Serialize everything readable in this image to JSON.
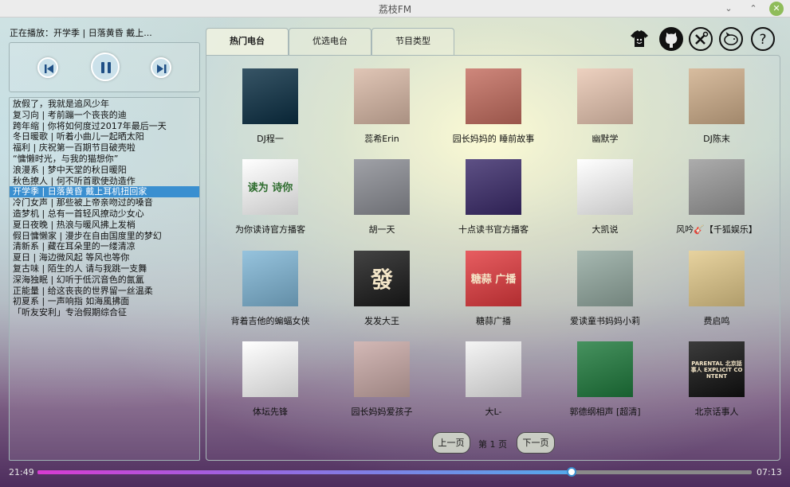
{
  "window": {
    "title": "荔枝FM"
  },
  "now_playing": {
    "label": "正在播放：",
    "text": "开学季 | 日落黄昏 戴上..."
  },
  "controls": {
    "prev_icon": "skip-previous-icon",
    "pause_icon": "pause-icon",
    "next_icon": "skip-next-icon"
  },
  "playlist": [
    {
      "text": "放假了，我就是追风少年"
    },
    {
      "text": "复习向 | 考前蹦一个丧丧的迪"
    },
    {
      "text": "跨年缩 | 你将如何度过2017年最后一天"
    },
    {
      "text": "冬日暖歌 | 听着小曲儿一起晒太阳"
    },
    {
      "text": "福利 | 庆祝第一百期节目破壳啦"
    },
    {
      "text": "“慵懒时光，与我的猫想你”"
    },
    {
      "text": "浪漫系 | 梦中天堂的秋日暖阳"
    },
    {
      "text": "秋色撩人 | 何不听首歌使劲造作"
    },
    {
      "text": "开学季 | 日落黄昏 戴上耳机扭回家",
      "active": true
    },
    {
      "text": "冷门女声 | 那些被上帝亲吻过的嗓音"
    },
    {
      "text": "造梦机 | 总有一首轻风撩动少女心"
    },
    {
      "text": "夏日夜晚 | 热浪与暖风拂上发梢"
    },
    {
      "text": "假日慵懒家 | 漫步在自由国度里的梦幻"
    },
    {
      "text": "清新系 | 藏在耳朵里的一缕清凉"
    },
    {
      "text": "夏日 | 海边微风起 等风也等你"
    },
    {
      "text": "复古味 | 陌生的人 请与我跳一支舞"
    },
    {
      "text": "深海独眠 | 幻听于低沉音色的氤氲"
    },
    {
      "text": "正能量 | 给这丧丧的世界留一丝温柔"
    },
    {
      "text": "初夏系 | 一声响指 如海風拂面"
    },
    {
      "text": "「听友安利」专治假期综合征"
    }
  ],
  "tabs": [
    {
      "label": "热门电台",
      "active": true
    },
    {
      "label": "优选电台"
    },
    {
      "label": "节目类型"
    }
  ],
  "toolbar": [
    {
      "icon": "tshirt-skin-icon"
    },
    {
      "icon": "github-icon"
    },
    {
      "icon": "tools-icon"
    },
    {
      "icon": "piggy-bank-icon"
    },
    {
      "icon": "help-icon",
      "glyph": "?"
    }
  ],
  "stations": [
    {
      "name": "DJ程一",
      "thumb_color": "#0b2f44"
    },
    {
      "name": "蕊希Erin",
      "thumb_color": "#d9b9a6"
    },
    {
      "name": "园长妈妈的 睡前故事",
      "thumb_color": "#c46d5f"
    },
    {
      "name": "幽默学",
      "thumb_color": "#e9c7b2"
    },
    {
      "name": "DJ陈末",
      "thumb_color": "#cfae8a"
    },
    {
      "name": "为你读诗官方播客",
      "thumb_color": "#ffffff",
      "thumb_text": "读为 诗你"
    },
    {
      "name": "胡一天",
      "thumb_color": "#8b8d94"
    },
    {
      "name": "十点读书官方播客",
      "thumb_color": "#3a2a6a"
    },
    {
      "name": "大凯说",
      "thumb_color": "#ffffff"
    },
    {
      "name": "风吟🎸【千狐娱乐】",
      "thumb_color": "#9a9a9a"
    },
    {
      "name": "背着吉他的蝙蝠女侠",
      "thumb_color": "#7fb6d6"
    },
    {
      "name": "发发大王",
      "thumb_color": "#1a1a1a",
      "thumb_text": "發"
    },
    {
      "name": "糖蒜广播",
      "thumb_color": "#e23a3e",
      "thumb_text": "糖蒜 广播"
    },
    {
      "name": "爱读童书妈妈小莉",
      "thumb_color": "#93a9a0"
    },
    {
      "name": "费启鸣",
      "thumb_color": "#e2c98a"
    },
    {
      "name": "体坛先锋",
      "thumb_color": "#ffffff"
    },
    {
      "name": "园长妈妈爱孩子",
      "thumb_color": "#c9a9a6"
    },
    {
      "name": "大L-",
      "thumb_color": "#f2f2f2"
    },
    {
      "name": "郭德纲相声 [超清]",
      "thumb_color": "#1e7a3c"
    },
    {
      "name": "北京话事人",
      "thumb_color": "#111111",
      "thumb_text": "PARENTAL 北京話事人 EXPLICIT CONTENT"
    }
  ],
  "pager": {
    "prev": "上一页",
    "label": "第 1 页",
    "next": "下一页"
  },
  "progress": {
    "elapsed": "21:49",
    "total": "07:13",
    "fraction": 0.748
  },
  "colors": {
    "accent": "#3a8fd0",
    "progress_start": "#d83bd2",
    "progress_end": "#55a9ea"
  }
}
